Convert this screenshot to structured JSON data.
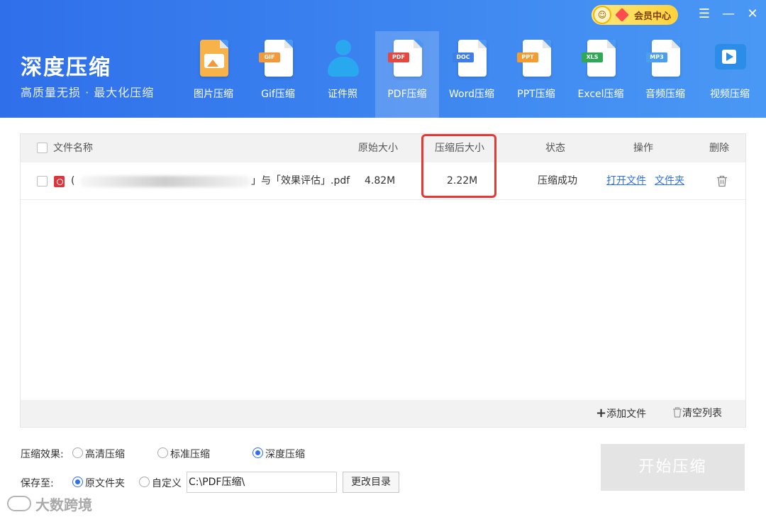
{
  "app": {
    "title": "深度压缩",
    "subtitle": "高质量无损 · 最大化压缩"
  },
  "vip": {
    "label": "会员中心",
    "icon": "vip-face-icon"
  },
  "window_controls": {
    "menu": "☰",
    "minimize": "—",
    "close": "✕"
  },
  "tools": [
    {
      "label": "图片压缩",
      "icon": "image-icon",
      "color": "#f5a03a",
      "tag": ""
    },
    {
      "label": "Gif压缩",
      "icon": "gif-icon",
      "color": "#f29a3b",
      "tag": "GIF"
    },
    {
      "label": "证件照",
      "icon": "id-photo-icon",
      "color": "#2aa8ef",
      "tag": ""
    },
    {
      "label": "PDF压缩",
      "icon": "pdf-icon",
      "color": "#e5483f",
      "tag": "PDF"
    },
    {
      "label": "Word压缩",
      "icon": "word-icon",
      "color": "#3f7ee8",
      "tag": "DOC"
    },
    {
      "label": "PPT压缩",
      "icon": "ppt-icon",
      "color": "#f39c32",
      "tag": "PPT"
    },
    {
      "label": "Excel压缩",
      "icon": "excel-icon",
      "color": "#2fa955",
      "tag": "XLS"
    },
    {
      "label": "音频压缩",
      "icon": "audio-icon",
      "color": "#4aa0ee",
      "tag": "MP3"
    },
    {
      "label": "视频压缩",
      "icon": "video-icon",
      "color": "#2b8de8",
      "tag": ""
    }
  ],
  "active_tool": "PDF压缩",
  "table": {
    "headers": {
      "name": "文件名称",
      "original_size": "原始大小",
      "compressed_size": "压缩后大小",
      "status": "状态",
      "actions": "操作",
      "delete": "删除"
    },
    "rows": [
      {
        "name_prefix": "(",
        "name_suffix": "」与「效果评估」.pdf",
        "original_size": "4.82M",
        "compressed_size": "2.22M",
        "status": "压缩成功",
        "open_file": "打开文件",
        "open_folder": "文件夹"
      }
    ],
    "footer": {
      "add_file": "添加文件",
      "clear_list": "清空列表"
    }
  },
  "options": {
    "effect_label": "压缩效果:",
    "effects": [
      "高清压缩",
      "标准压缩",
      "深度压缩"
    ],
    "selected_effect": "深度压缩",
    "save_label": "保存至:",
    "save_targets": [
      "原文件夹",
      "自定义"
    ],
    "selected_save": "原文件夹",
    "path": "C:\\PDF压缩\\",
    "change_dir": "更改目录"
  },
  "start_button": "开始压缩",
  "watermark": "大数跨境",
  "colors": {
    "accent": "#2f6fea",
    "highlight": "#e53935",
    "pdf": "#d9363e"
  }
}
